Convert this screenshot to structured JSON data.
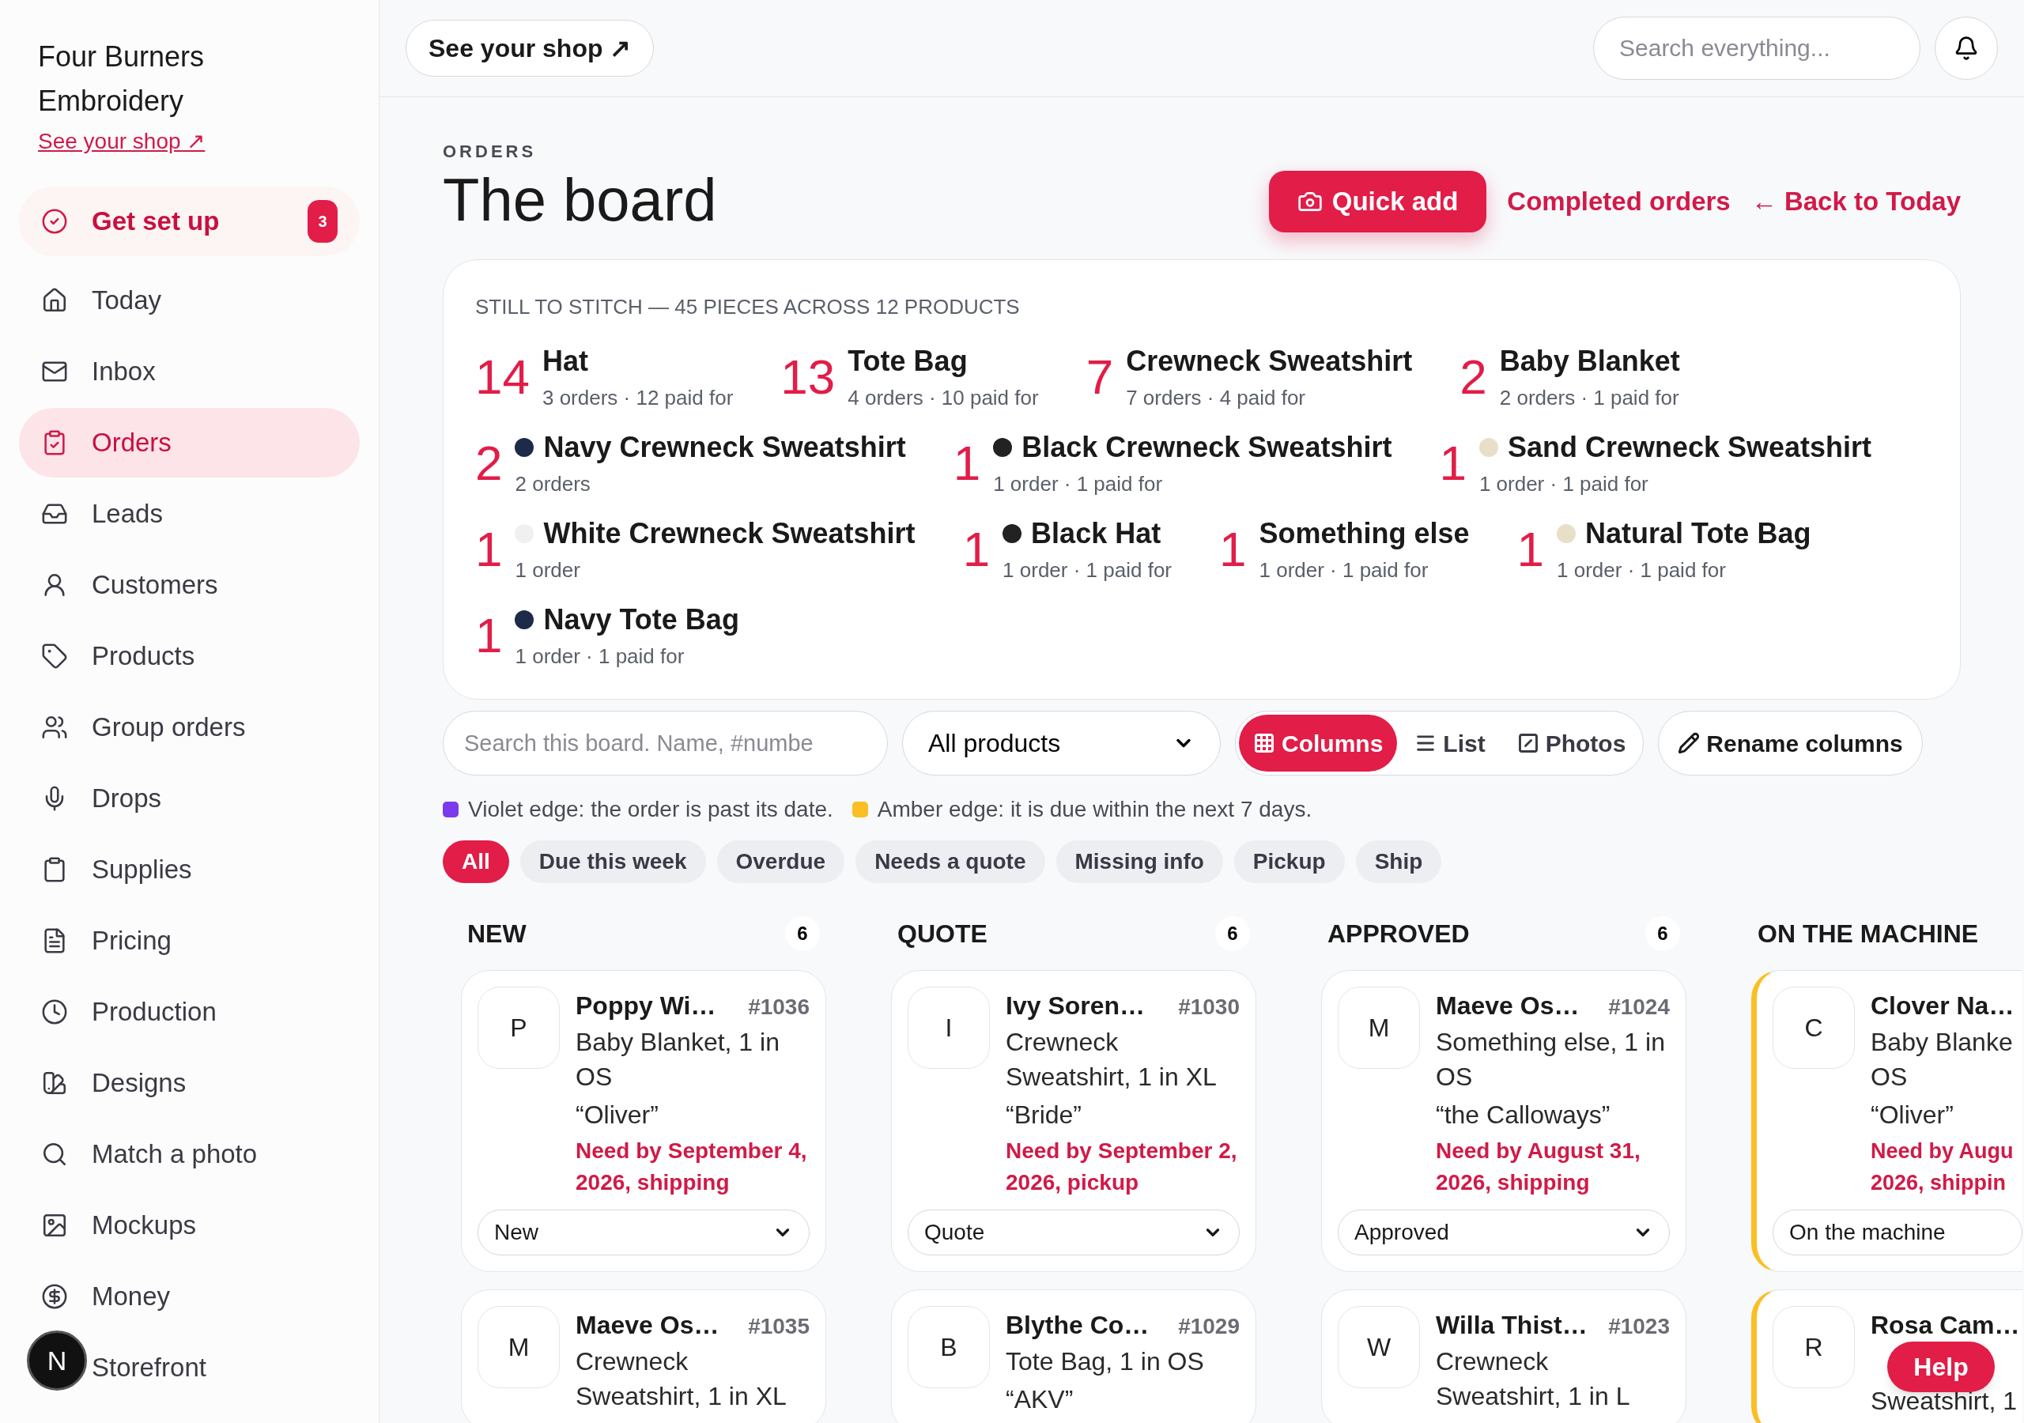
{
  "sidebar": {
    "shop_name": "Four Burners Embroidery",
    "shop_link": "See your shop ↗",
    "items": [
      {
        "label": "Get set up",
        "selected": false,
        "highlight": true,
        "badge": "3"
      },
      {
        "label": "Today",
        "selected": false,
        "highlight": false
      },
      {
        "label": "Inbox",
        "selected": false,
        "highlight": false
      },
      {
        "label": "Orders",
        "selected": true,
        "highlight": false
      },
      {
        "label": "Leads",
        "selected": false,
        "highlight": false
      },
      {
        "label": "Customers",
        "selected": false,
        "highlight": false
      },
      {
        "label": "Products",
        "selected": false,
        "highlight": false
      },
      {
        "label": "Group orders",
        "selected": false,
        "highlight": false
      },
      {
        "label": "Drops",
        "selected": false,
        "highlight": false
      },
      {
        "label": "Supplies",
        "selected": false,
        "highlight": false
      },
      {
        "label": "Pricing",
        "selected": false,
        "highlight": false
      },
      {
        "label": "Production",
        "selected": false,
        "highlight": false
      },
      {
        "label": "Designs",
        "selected": false,
        "highlight": false
      },
      {
        "label": "Match a photo",
        "selected": false,
        "highlight": false
      },
      {
        "label": "Mockups",
        "selected": false,
        "highlight": false
      },
      {
        "label": "Money",
        "selected": false,
        "highlight": false
      },
      {
        "label": "Storefront",
        "selected": false,
        "highlight": false
      }
    ],
    "dev_badge": "N"
  },
  "topbar": {
    "shop_button": "See your shop ↗",
    "search": {
      "placeholder": "Search everything..."
    }
  },
  "header": {
    "eyebrow": "ORDERS",
    "title": "The board",
    "quick_add": "Quick add",
    "links": [
      "Completed orders",
      "← Back to Today"
    ]
  },
  "summary": {
    "title": "STILL TO STITCH — 45 PIECES ACROSS 12 PRODUCTS",
    "items": [
      {
        "count": "14",
        "name": "Hat",
        "detail": "3 orders · 12 paid for"
      },
      {
        "count": "13",
        "name": "Tote Bag",
        "detail": "4 orders · 10 paid for"
      },
      {
        "count": "7",
        "name": "Crewneck Sweatshirt",
        "detail": "7 orders · 4 paid for"
      },
      {
        "count": "2",
        "name": "Baby Blanket",
        "detail": "2 orders · 1 paid for"
      },
      {
        "count": "2",
        "name": "Navy Crewneck Sweatshirt",
        "detail": "2 orders",
        "color": "#1e2a4a"
      },
      {
        "count": "1",
        "name": "Black Crewneck Sweatshirt",
        "detail": "1 order · 1 paid for",
        "color": "#222222"
      },
      {
        "count": "1",
        "name": "Sand Crewneck Sweatshirt",
        "detail": "1 order · 1 paid for",
        "color": "#e8dfc8"
      },
      {
        "count": "1",
        "name": "White Crewneck Sweatshirt",
        "detail": "1 order",
        "color": "#f0f0f0"
      },
      {
        "count": "1",
        "name": "Black Hat",
        "detail": "1 order · 1 paid for",
        "color": "#222222"
      },
      {
        "count": "1",
        "name": "Something else",
        "detail": "1 order · 1 paid for"
      },
      {
        "count": "1",
        "name": "Natural Tote Bag",
        "detail": "1 order · 1 paid for",
        "color": "#e8dfc8"
      },
      {
        "count": "1",
        "name": "Navy Tote Bag",
        "detail": "1 order · 1 paid for",
        "color": "#1e2a4a"
      }
    ]
  },
  "toolbar": {
    "search": {
      "placeholder": "Search this board. Name, #numbe"
    },
    "product_filter": "All products",
    "views": [
      {
        "label": "Columns",
        "selected": true
      },
      {
        "label": "List",
        "selected": false
      },
      {
        "label": "Photos",
        "selected": false
      }
    ],
    "rename": "Rename columns"
  },
  "legend": [
    {
      "text": "Violet edge: the order is past its date.",
      "color": "#7c3aed"
    },
    {
      "text": "Amber edge: it is due within the next 7 days.",
      "color": "#fbbf24"
    }
  ],
  "filters": [
    {
      "label": "All",
      "selected": true
    },
    {
      "label": "Due this week",
      "selected": false
    },
    {
      "label": "Overdue",
      "selected": false
    },
    {
      "label": "Needs a quote",
      "selected": false
    },
    {
      "label": "Missing info",
      "selected": false
    },
    {
      "label": "Pickup",
      "selected": false
    },
    {
      "label": "Ship",
      "selected": false
    }
  ],
  "columns": [
    {
      "title": "NEW",
      "count": "6",
      "cards": [
        {
          "initial": "P",
          "name": "Poppy Wi…",
          "number": "#1036",
          "product": "Baby Blanket, 1 in OS",
          "note": "“Oliver”",
          "need": "Need by September 4, 2026, shipping",
          "status": "New"
        },
        {
          "initial": "M",
          "name": "Maeve Os…",
          "number": "#1035",
          "product": "Crewneck Sweatshirt, 1 in XL"
        }
      ]
    },
    {
      "title": "QUOTE",
      "count": "6",
      "cards": [
        {
          "initial": "I",
          "name": "Ivy Soren…",
          "number": "#1030",
          "product": "Crewneck Sweatshirt, 1 in XL",
          "note": "“Bride”",
          "need": "Need by September 2, 2026, pickup",
          "status": "Quote"
        },
        {
          "initial": "B",
          "name": "Blythe Co…",
          "number": "#1029",
          "product": "Tote Bag, 1 in OS",
          "note": "“AKV”"
        }
      ]
    },
    {
      "title": "APPROVED",
      "count": "6",
      "cards": [
        {
          "initial": "M",
          "name": "Maeve Os…",
          "number": "#1024",
          "product": "Something else, 1 in OS",
          "note": "“the Calloways”",
          "need": "Need by August 31, 2026, shipping",
          "status": "Approved"
        },
        {
          "initial": "W",
          "name": "Willa Thist…",
          "number": "#1023",
          "product": "Crewneck Sweatshirt, 1 in L"
        }
      ]
    },
    {
      "title": "ON THE MACHINE",
      "cards": [
        {
          "initial": "C",
          "name": "Clover Na…",
          "product": "Baby Blanke\nOS",
          "note": "“Oliver”",
          "need": "Need by Augu\n2026, shippin",
          "status": "On the machine",
          "color": "#fbbf24"
        },
        {
          "initial": "R",
          "name": "Rosa Cam…",
          "product": "\nSweatshirt, 1",
          "color": "#fbbf24"
        }
      ]
    }
  ],
  "help": "Help"
}
